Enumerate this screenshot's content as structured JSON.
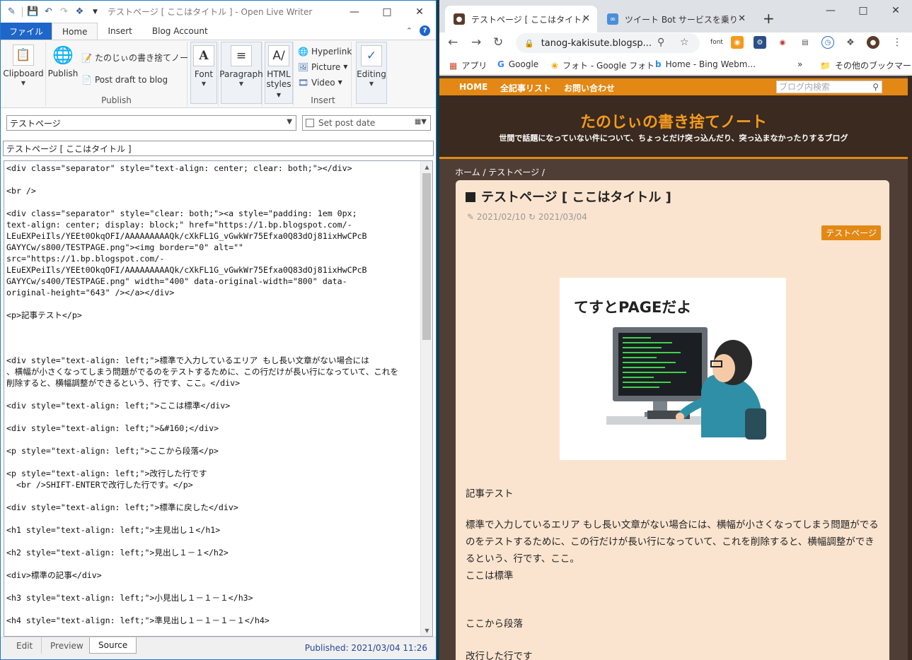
{
  "olw": {
    "title": "テストページ [ ここはタイトル ] - Open Live Writer",
    "tabs": {
      "file": "ファイル",
      "home": "Home",
      "insert": "Insert",
      "blog_account": "Blog Account"
    },
    "ribbon": {
      "clipboard": "Clipboard",
      "publish": "Publish",
      "blog_name": "たのじぃの書き捨てノート",
      "post_draft": "Post draft to blog",
      "publish_group": "Publish",
      "font": "Font",
      "paragraph": "Paragraph",
      "html_styles_1": "HTML",
      "html_styles_2": "styles",
      "hyperlink": "Hyperlink",
      "picture": "Picture",
      "video": "Video",
      "insert_group": "Insert",
      "editing": "Editing"
    },
    "category_select": "テストページ",
    "set_post_date": "Set post date",
    "post_title": "テストページ [ ここはタイトル ]",
    "source_lines": [
      "<div class=\"separator\" style=\"text-align: center; clear: both;\"></div>",
      "",
      "<br />",
      "",
      "<div class=\"separator\" style=\"clear: both;\"><a style=\"padding: 1em 0px;",
      "text-align: center; display: block;\" href=\"https://1.bp.blogspot.com/-",
      "LEuEXPeiIls/YEEt0OkqOFI/AAAAAAAAAQk/cXkFL1G_vGwkWr75Efxa0Q83dOj81ixHwCPcB",
      "GAYYCw/s800/TESTPAGE.png\"><img border=\"0\" alt=\"\"",
      "src=\"https://1.bp.blogspot.com/-",
      "LEuEXPeiIls/YEEt0OkqOFI/AAAAAAAAAQk/cXkFL1G_vGwkWr75Efxa0Q83dOj81ixHwCPcB",
      "GAYYCw/s400/TESTPAGE.png\" width=\"400\" data-original-width=\"800\" data-",
      "original-height=\"643\" /></a></div>",
      "",
      "<p>記事テスト</p>",
      "",
      "",
      "",
      "<div style=\"text-align: left;\">標準で入力しているエリア もし長い文章がない場合には",
      "、横幅が小さくなってしまう問題がでるのをテストするために、この行だけが長い行になっていて、これを",
      "削除すると、横幅調整ができるという、行です、ここ。</div>",
      "",
      "<div style=\"text-align: left;\">ここは標準</div>",
      "",
      "<div style=\"text-align: left;\">&#160;</div>",
      "",
      "<p style=\"text-align: left;\">ここから段落</p>",
      "",
      "<p style=\"text-align: left;\">改行した行です",
      "  <br />SHIFT-ENTERで改行した行です。</p>",
      "",
      "<div style=\"text-align: left;\">標準に戻した</div>",
      "",
      "<h1 style=\"text-align: left;\">主見出し１</h1>",
      "",
      "<h2 style=\"text-align: left;\">見出し１－１</h2>",
      "",
      "<div>標準の記事</div>",
      "",
      "<h3 style=\"text-align: left;\">小見出し１－１－１</h3>",
      "",
      "<h4 style=\"text-align: left;\">準見出し１－１－１－１</h4>"
    ],
    "view_tabs": {
      "edit": "Edit",
      "preview": "Preview",
      "source": "Source"
    },
    "published": "Published: 2021/03/04 11:26"
  },
  "chrome": {
    "tab1_title": "テストページ [ ここはタイトル ]-たの",
    "tab2_title": "ツイート Bot サービスを乗り換えた",
    "url": "tanog-kakisute.blogsp...",
    "ext_font": "font",
    "bookmarks": {
      "apps": "アプリ",
      "google": "Google",
      "photos": "フォト - Google フォト",
      "bing": "Home - Bing Webm...",
      "more": "»",
      "other": "その他のブックマーク"
    }
  },
  "blog": {
    "nav": {
      "home": "HOME",
      "all": "全記事リスト",
      "contact": "お問い合わせ"
    },
    "search_placeholder": "ブログ内検索",
    "title": "たのじぃの書き捨てノート",
    "subtitle": "世間で話題になっていない件について、ちょっとだけ突っ込んだり、突っ込まなかったりするブログ",
    "breadcrumb": "ホーム / テストページ /",
    "post_title": "テストページ [ ここはタイトル ]",
    "published_date": "2021/02/10",
    "updated_date": "2021/03/04",
    "label": "テストページ",
    "image_caption": "てすとPAGEだよ",
    "body_1": "記事テスト",
    "body_2": "標準で入力しているエリア もし長い文章がない場合には、横幅が小さくなってしまう問題がでるのをテストするために、この行だけが長い行になっていて、これを削除すると、横幅調整ができるという、行です、ここ。",
    "body_3": "ここは標準",
    "body_4": "ここから段落",
    "body_5": "改行した行です"
  }
}
